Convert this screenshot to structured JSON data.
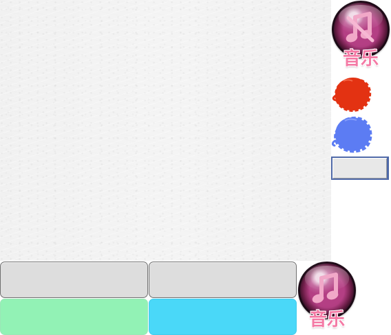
{
  "screen": {
    "name": "music-toy-ui"
  },
  "music_controls": {
    "top": {
      "label": "音乐",
      "icon": "music-muted-icon",
      "accent_color": "#f47aa5"
    },
    "bottom": {
      "label": "音乐",
      "icon": "music-note-icon",
      "accent_color": "#f47aa5"
    }
  },
  "ink_buttons": [
    {
      "color_name": "red",
      "color": "#e33212",
      "icon": "red-ink-blot-icon"
    },
    {
      "color_name": "blue",
      "color": "#5c7cf3",
      "icon": "blue-ink-blot-icon"
    }
  ],
  "small_field": {
    "value": "",
    "background": "#e8e8e8",
    "border": "#4f69a8"
  },
  "panel_buttons": [
    {
      "label": "",
      "color": "#dddddd"
    },
    {
      "label": "",
      "color": "#dddddd"
    },
    {
      "label": "",
      "color": "#92f2b5"
    },
    {
      "label": "",
      "color": "#4ad8f8"
    }
  ],
  "colors": {
    "paper": "#f4f4f4",
    "gray_button": "#dddddd",
    "green_button": "#92f2b5",
    "cyan_button": "#4ad8f8",
    "pink_text": "#f47aa5",
    "purple_disc": "#a33a78"
  }
}
